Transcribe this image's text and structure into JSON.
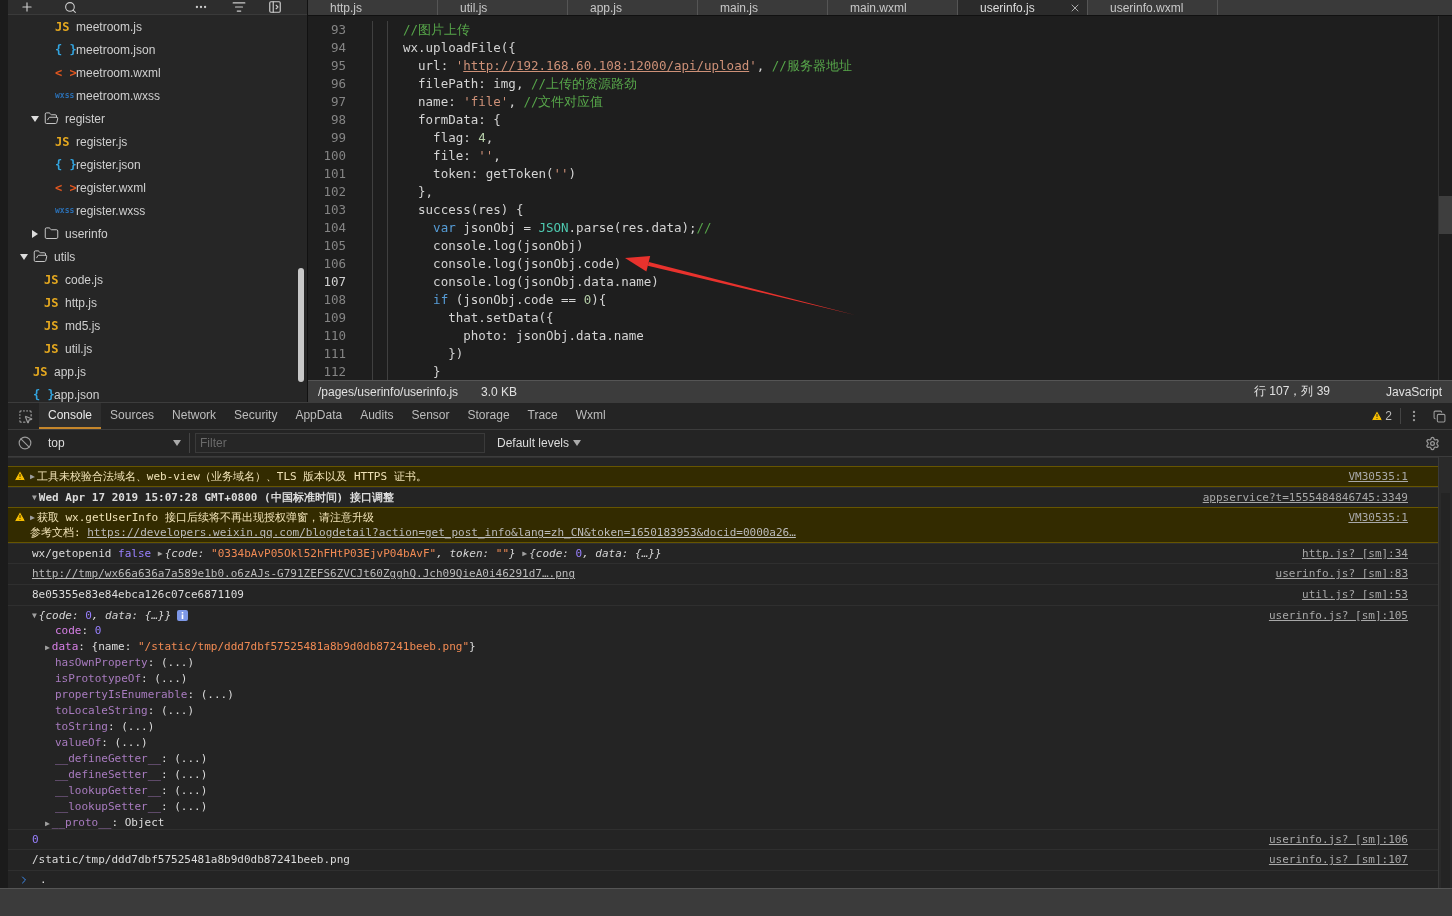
{
  "sidebar": {
    "tree": [
      {
        "children": [
          {
            "children": [
              {
                "kind": "js",
                "icon": "JS",
                "label": "meetroom.js"
              },
              {
                "kind": "json",
                "icon": "{ }",
                "label": "meetroom.json"
              },
              {
                "kind": "wxml",
                "icon": "< >",
                "label": "meetroom.wxml"
              },
              {
                "kind": "wxss",
                "icon": "wxss",
                "label": "meetroom.wxss"
              }
            ]
          },
          {
            "kind": "folder",
            "label": "register",
            "expanded": true,
            "children": [
              {
                "kind": "js",
                "icon": "JS",
                "label": "register.js"
              },
              {
                "kind": "json",
                "icon": "{ }",
                "label": "register.json"
              },
              {
                "kind": "wxml",
                "icon": "< >",
                "label": "register.wxml"
              },
              {
                "kind": "wxss",
                "icon": "wxss",
                "label": "register.wxss"
              }
            ]
          },
          {
            "kind": "folder",
            "label": "userinfo",
            "expanded": false
          }
        ]
      },
      {
        "kind": "folder",
        "label": "utils",
        "expanded": true,
        "children": [
          {
            "kind": "js",
            "icon": "JS",
            "label": "code.js"
          },
          {
            "kind": "js",
            "icon": "JS",
            "label": "http.js"
          },
          {
            "kind": "js",
            "icon": "JS",
            "label": "md5.js"
          },
          {
            "kind": "js",
            "icon": "JS",
            "label": "util.js"
          }
        ]
      },
      {
        "kind": "js",
        "icon": "JS",
        "label": "app.js"
      },
      {
        "kind": "json",
        "icon": "{ }",
        "label": "app.json"
      }
    ]
  },
  "editor": {
    "tabs": [
      {
        "label": "http.js",
        "selected": false
      },
      {
        "label": "util.js",
        "selected": false
      },
      {
        "label": "app.js",
        "selected": false
      },
      {
        "label": "main.js",
        "selected": false
      },
      {
        "label": "main.wxml",
        "selected": false
      },
      {
        "label": "userinfo.js",
        "selected": true
      },
      {
        "label": "userinfo.wxml",
        "selected": false
      }
    ],
    "lines": [
      {
        "number": "93",
        "current": false,
        "tokens": [
          {
            "text": "//图片上传",
            "kind": "comment"
          }
        ]
      },
      {
        "number": "94",
        "current": false,
        "tokens": [
          {
            "text": "wx.uploadFile({",
            "kind": "plain"
          }
        ]
      },
      {
        "number": "95",
        "current": false,
        "tokens": [
          {
            "text": "  url: ",
            "kind": "plain"
          },
          {
            "text": "'",
            "kind": "string"
          },
          {
            "text": "http://192.168.60.108:12000/api/upload",
            "kind": "url"
          },
          {
            "text": "'",
            "kind": "string"
          },
          {
            "text": ", ",
            "kind": "plain"
          },
          {
            "text": "//服务器地址",
            "kind": "comment"
          }
        ]
      },
      {
        "number": "96",
        "current": false,
        "tokens": [
          {
            "text": "  filePath: img, ",
            "kind": "plain"
          },
          {
            "text": "//上传的资源路劲",
            "kind": "comment"
          }
        ]
      },
      {
        "number": "97",
        "current": false,
        "tokens": [
          {
            "text": "  name: ",
            "kind": "plain"
          },
          {
            "text": "'file'",
            "kind": "string"
          },
          {
            "text": ", ",
            "kind": "plain"
          },
          {
            "text": "//文件对应值",
            "kind": "comment"
          }
        ]
      },
      {
        "number": "98",
        "current": false,
        "tokens": [
          {
            "text": "  formData: {",
            "kind": "plain"
          }
        ]
      },
      {
        "number": "99",
        "current": false,
        "tokens": [
          {
            "text": "    flag: ",
            "kind": "plain"
          },
          {
            "text": "4",
            "kind": "number"
          },
          {
            "text": ",",
            "kind": "plain"
          }
        ]
      },
      {
        "number": "100",
        "current": false,
        "tokens": [
          {
            "text": "    file: ",
            "kind": "plain"
          },
          {
            "text": "''",
            "kind": "string"
          },
          {
            "text": ",",
            "kind": "plain"
          }
        ]
      },
      {
        "number": "101",
        "current": false,
        "tokens": [
          {
            "text": "    token: getToken(",
            "kind": "plain"
          },
          {
            "text": "''",
            "kind": "string"
          },
          {
            "text": ")",
            "kind": "plain"
          }
        ]
      },
      {
        "number": "102",
        "current": false,
        "tokens": [
          {
            "text": "  },",
            "kind": "plain"
          }
        ]
      },
      {
        "number": "103",
        "current": false,
        "tokens": [
          {
            "text": "  success(res) {",
            "kind": "plain"
          }
        ]
      },
      {
        "number": "104",
        "current": false,
        "tokens": [
          {
            "text": "    var",
            "kind": "keyword"
          },
          {
            "text": " jsonObj = ",
            "kind": "plain"
          },
          {
            "text": "JSON",
            "kind": "builtin"
          },
          {
            "text": ".parse(res.data);",
            "kind": "plain"
          },
          {
            "text": "//",
            "kind": "comment"
          }
        ]
      },
      {
        "number": "105",
        "current": false,
        "tokens": [
          {
            "text": "    console.log(jsonObj)",
            "kind": "plain"
          }
        ]
      },
      {
        "number": "106",
        "current": false,
        "tokens": [
          {
            "text": "    console.log(jsonObj.code)",
            "kind": "plain"
          }
        ]
      },
      {
        "number": "107",
        "current": true,
        "tokens": [
          {
            "text": "    console.log(jsonObj.data.name)",
            "kind": "plain"
          }
        ]
      },
      {
        "number": "108",
        "current": false,
        "tokens": [
          {
            "text": "    if",
            "kind": "keyword"
          },
          {
            "text": " (jsonObj.code == ",
            "kind": "plain"
          },
          {
            "text": "0",
            "kind": "number"
          },
          {
            "text": "){",
            "kind": "plain"
          }
        ]
      },
      {
        "number": "109",
        "current": false,
        "tokens": [
          {
            "text": "      that.setData({",
            "kind": "plain"
          }
        ]
      },
      {
        "number": "110",
        "current": false,
        "tokens": [
          {
            "text": "        photo: jsonObj.data.name",
            "kind": "plain"
          }
        ]
      },
      {
        "number": "111",
        "current": false,
        "tokens": [
          {
            "text": "      })",
            "kind": "plain"
          }
        ]
      },
      {
        "number": "112",
        "current": false,
        "tokens": [
          {
            "text": "    }",
            "kind": "plain"
          }
        ]
      }
    ]
  },
  "status_bar": {
    "path": "/pages/userinfo/userinfo.js",
    "size": "3.0 KB",
    "position": "行 107，列 39",
    "language": "JavaScript"
  },
  "devtools": {
    "tabs": [
      {
        "label": "Console",
        "selected": true
      },
      {
        "label": "Sources",
        "selected": false
      },
      {
        "label": "Network",
        "selected": false
      },
      {
        "label": "Security",
        "selected": false
      },
      {
        "label": "AppData",
        "selected": false
      },
      {
        "label": "Audits",
        "selected": false
      },
      {
        "label": "Sensor",
        "selected": false
      },
      {
        "label": "Storage",
        "selected": false
      },
      {
        "label": "Trace",
        "selected": false
      },
      {
        "label": "Wxml",
        "selected": false
      }
    ],
    "warning_count": "2"
  },
  "filter_bar": {
    "context": "top",
    "filter_placeholder": "Filter",
    "levels": "Default levels"
  },
  "console": {
    "messages": [
      {
        "kind": "warning",
        "source": "VM30535:1",
        "lines": [
          [
            {
              "text": "▶",
              "kind": "arrow"
            },
            {
              "text": "工具未校验合法域名、web-view（业务域名）、TLS 版本以及 HTTPS 证书。",
              "kind": "text"
            }
          ]
        ]
      },
      {
        "kind": "group",
        "source": "appservice?t=1555484846745:3349",
        "lines": [
          [
            {
              "text": "▼",
              "kind": "arrow"
            },
            {
              "text": "Wed Apr 17 2019 15:07:28 GMT+0800 (中国标准时间) 接口调整",
              "kind": "text"
            }
          ]
        ]
      },
      {
        "kind": "warning",
        "source": "VM30535:1",
        "lines": [
          [
            {
              "text": "▶",
              "kind": "arrow"
            },
            {
              "text": "获取 wx.getUserInfo 接口后续将不再出现授权弹窗，请注意升级",
              "kind": "text"
            }
          ],
          [
            {
              "text": "参考文档: ",
              "kind": "text"
            },
            {
              "text": "https://developers.weixin.qq.com/blogdetail?action=get_post_info&lang=zh_CN&token=1650183953&docid=0000a26…",
              "kind": "link"
            }
          ]
        ]
      },
      {
        "kind": "log",
        "source": "http.js? [sm]:34",
        "lines": [
          [
            {
              "text": "wx/getopenid ",
              "kind": "text"
            },
            {
              "text": "false ",
              "kind": "keyword"
            },
            {
              "text": "▶",
              "kind": "arrow"
            },
            {
              "text": "{code: ",
              "kind": "preview"
            },
            {
              "text": "\"0334bAvP05Okl52hFHtP03EjvP04bAvF\"",
              "kind": "string"
            },
            {
              "text": ", token: ",
              "kind": "preview"
            },
            {
              "text": "\"\"",
              "kind": "string"
            },
            {
              "text": "} ",
              "kind": "preview"
            },
            {
              "text": "▶",
              "kind": "arrow"
            },
            {
              "text": "{code: ",
              "kind": "preview"
            },
            {
              "text": "0",
              "kind": "number"
            },
            {
              "text": ", data: {…}}",
              "kind": "preview"
            }
          ]
        ]
      },
      {
        "kind": "log",
        "source": "userinfo.js? [sm]:83",
        "lines": [
          [
            {
              "text": "http://tmp/wx66a636a7a589e1b0.o6zAJs-G791ZEFS6ZVCJt60ZgghQ.Jch09QieA0i46291d7….png",
              "kind": "link"
            }
          ]
        ]
      },
      {
        "kind": "log",
        "source": "util.js? [sm]:53",
        "lines": [
          [
            {
              "text": "8e05355e83e84ebca126c07ce6871109",
              "kind": "text"
            }
          ]
        ]
      },
      {
        "kind": "object",
        "source": "userinfo.js? [sm]:105",
        "lines": [
          [
            {
              "text": "▼",
              "kind": "arrow"
            },
            {
              "text": "{code: ",
              "kind": "preview"
            },
            {
              "text": "0",
              "kind": "number"
            },
            {
              "text": ", data: {…}}",
              "kind": "preview"
            }
          ]
        ],
        "properties": [
          [
            {
              "text": "code",
              "kind": "prop"
            },
            {
              "text": ": ",
              "kind": "text"
            },
            {
              "text": "0",
              "kind": "number"
            }
          ],
          [
            {
              "text": "▶",
              "kind": "arrow"
            },
            {
              "text": "data",
              "kind": "prop"
            },
            {
              "text": ": {name: ",
              "kind": "text"
            },
            {
              "text": "\"/static/tmp/ddd7dbf57525481a8b9d0db87241beeb.png\"",
              "kind": "string"
            },
            {
              "text": "}",
              "kind": "text"
            }
          ],
          [
            {
              "text": "hasOwnProperty",
              "kind": "inherited"
            },
            {
              "text": ": (...)",
              "kind": "text"
            }
          ],
          [
            {
              "text": "isPrototypeOf",
              "kind": "inherited"
            },
            {
              "text": ": (...)",
              "kind": "text"
            }
          ],
          [
            {
              "text": "propertyIsEnumerable",
              "kind": "inherited"
            },
            {
              "text": ": (...)",
              "kind": "text"
            }
          ],
          [
            {
              "text": "toLocaleString",
              "kind": "inherited"
            },
            {
              "text": ": (...)",
              "kind": "text"
            }
          ],
          [
            {
              "text": "toString",
              "kind": "inherited"
            },
            {
              "text": ": (...)",
              "kind": "text"
            }
          ],
          [
            {
              "text": "valueOf",
              "kind": "inherited"
            },
            {
              "text": ": (...)",
              "kind": "text"
            }
          ],
          [
            {
              "text": "__defineGetter__",
              "kind": "inherited"
            },
            {
              "text": ": (...)",
              "kind": "text"
            }
          ],
          [
            {
              "text": "__defineSetter__",
              "kind": "inherited"
            },
            {
              "text": ": (...)",
              "kind": "text"
            }
          ],
          [
            {
              "text": "__lookupGetter__",
              "kind": "inherited"
            },
            {
              "text": ": (...)",
              "kind": "text"
            }
          ],
          [
            {
              "text": "__lookupSetter__",
              "kind": "inherited"
            },
            {
              "text": ": (...)",
              "kind": "text"
            }
          ],
          [
            {
              "text": "▶",
              "kind": "arrow"
            },
            {
              "text": "__proto__",
              "kind": "inherited"
            },
            {
              "text": ": Object",
              "kind": "text"
            }
          ]
        ]
      },
      {
        "kind": "log",
        "source": "userinfo.js? [sm]:106",
        "lines": [
          [
            {
              "text": "0",
              "kind": "number"
            }
          ]
        ]
      },
      {
        "kind": "log",
        "source": "userinfo.js? [sm]:107",
        "lines": [
          [
            {
              "text": "/static/tmp/ddd7dbf57525481a8b9d0db87241beeb.png",
              "kind": "text"
            }
          ]
        ]
      }
    ],
    "prompt": {
      "value": "."
    }
  }
}
